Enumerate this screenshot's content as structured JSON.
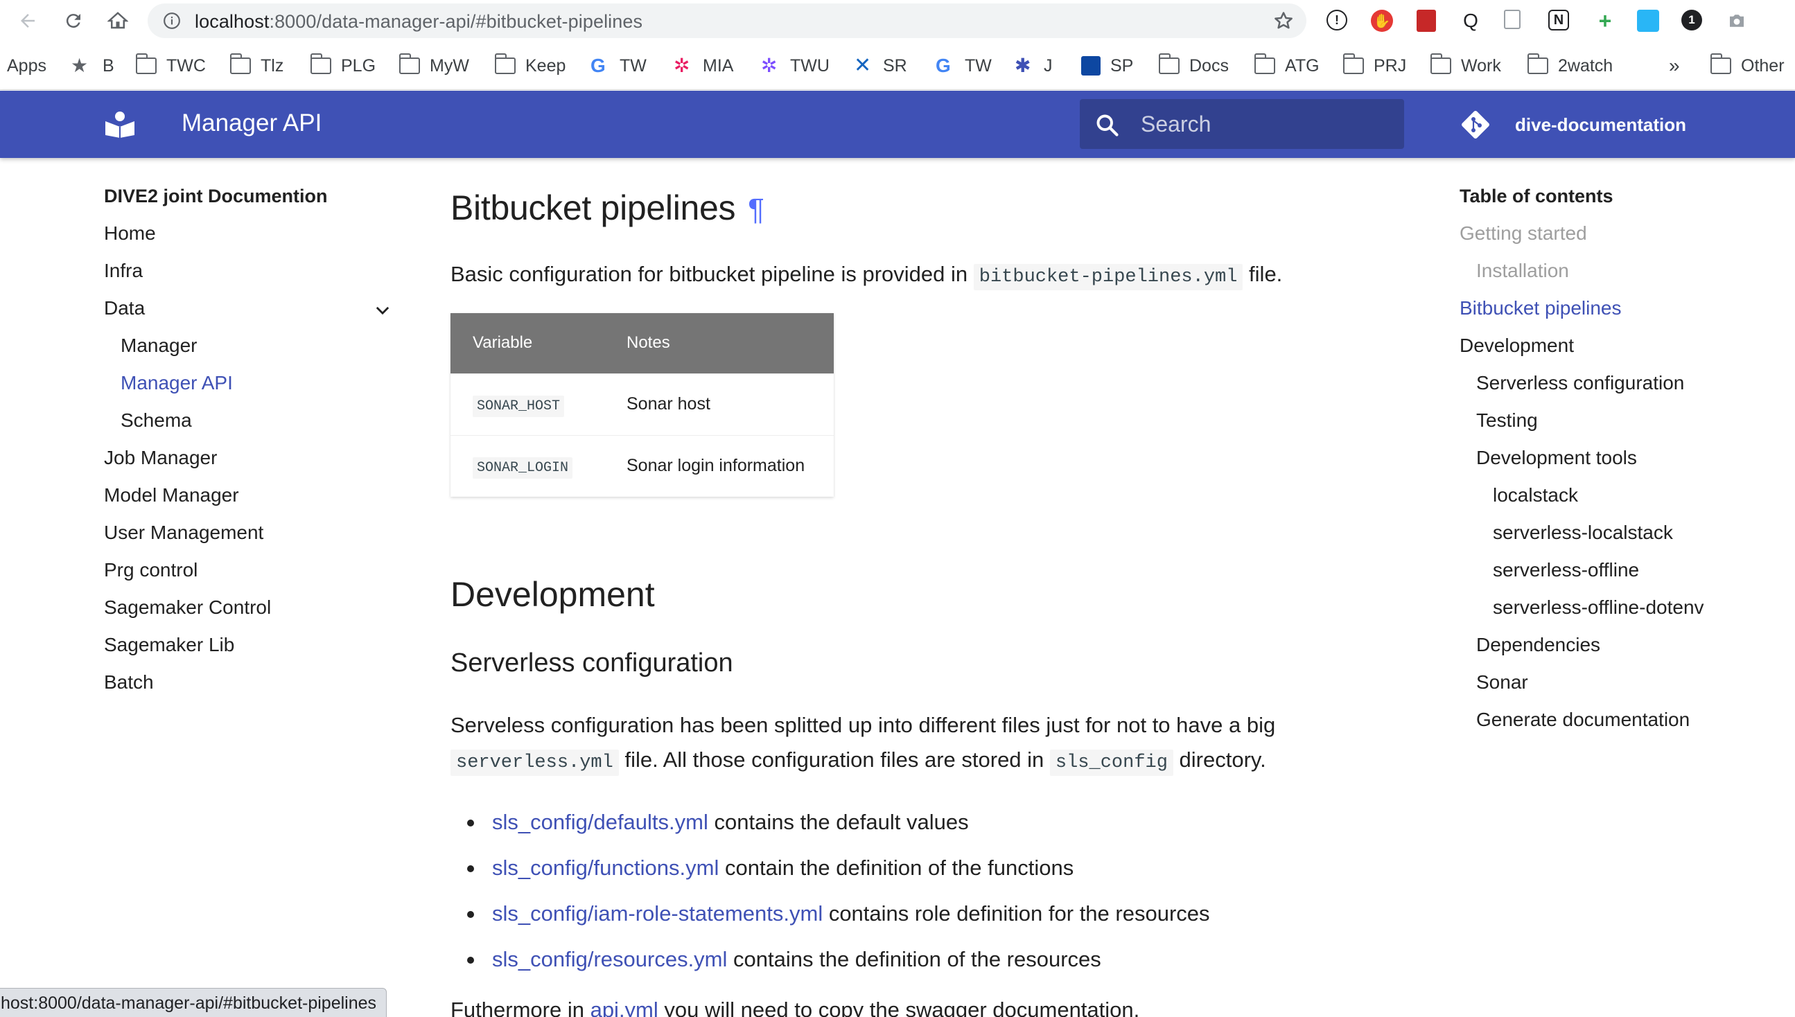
{
  "browser": {
    "url_host": "localhost",
    "url_rest": ":8000/data-manager-api/#bitbucket-pipelines",
    "bookmarks": [
      {
        "label": "Apps",
        "icon": "apps-icon"
      },
      {
        "label": "B",
        "icon": "star-icon"
      },
      {
        "label": "TWC",
        "icon": "folder-icon"
      },
      {
        "label": "Tlz",
        "icon": "folder-icon"
      },
      {
        "label": "PLG",
        "icon": "folder-icon"
      },
      {
        "label": "MyW",
        "icon": "folder-icon"
      },
      {
        "label": "Keep",
        "icon": "folder-icon"
      },
      {
        "label": "TW",
        "icon": "google-icon"
      },
      {
        "label": "MIA",
        "icon": "pinwheel-icon"
      },
      {
        "label": "TWU",
        "icon": "pinwheel-icon"
      },
      {
        "label": "SR",
        "icon": "confluence-icon"
      },
      {
        "label": "TW",
        "icon": "google-icon"
      },
      {
        "label": "J",
        "icon": "jira-icon"
      },
      {
        "label": "SP",
        "icon": "trello-icon"
      },
      {
        "label": "Docs",
        "icon": "folder-icon"
      },
      {
        "label": "ATG",
        "icon": "folder-icon"
      },
      {
        "label": "PRJ",
        "icon": "folder-icon"
      },
      {
        "label": "Work",
        "icon": "folder-icon"
      },
      {
        "label": "2watch",
        "icon": "folder-icon"
      },
      {
        "label": "Other",
        "icon": "folder-icon"
      }
    ],
    "overflow_label": "»",
    "status_bubble": "host:8000/data-manager-api/#bitbucket-pipelines"
  },
  "header": {
    "site_title": "Manager API",
    "search_placeholder": "Search",
    "repo_name": "dive-documentation"
  },
  "left_nav": {
    "title": "DIVE2 joint Documention",
    "items": [
      {
        "label": "Home"
      },
      {
        "label": "Infra"
      },
      {
        "label": "Data"
      },
      {
        "label": "Manager"
      },
      {
        "label": "Manager API"
      },
      {
        "label": "Schema"
      },
      {
        "label": "Job Manager"
      },
      {
        "label": "Model Manager"
      },
      {
        "label": "User Management"
      },
      {
        "label": "Prg control"
      },
      {
        "label": "Sagemaker Control"
      },
      {
        "label": "Sagemaker Lib"
      },
      {
        "label": "Batch"
      }
    ]
  },
  "content": {
    "h1": "Bitbucket pipelines",
    "pilcrow": "¶",
    "intro_before": "Basic configuration for bitbucket pipeline is provided in ",
    "intro_code": "bitbucket-pipelines.yml",
    "intro_after": " file.",
    "table": {
      "headers": [
        "Variable",
        "Notes"
      ],
      "rows": [
        {
          "variable": "SONAR_HOST",
          "notes": "Sonar host"
        },
        {
          "variable": "SONAR_LOGIN",
          "notes": "Sonar login information"
        }
      ]
    },
    "h2": "Development",
    "h3": "Serverless configuration",
    "para1_a": "Serveless configuration has been splitted up into different files just for not to have a big",
    "para1_code1": "serverless.yml",
    "para1_b": " file. All those configuration files are stored in ",
    "para1_code2": "sls_config",
    "para1_c": " directory.",
    "files": [
      {
        "link": "sls_config/defaults.yml",
        "text": " contains the default values"
      },
      {
        "link": "sls_config/functions.yml",
        "text": " contain the definition of the functions"
      },
      {
        "link": "sls_config/iam-role-statements.yml",
        "text": " contains role definition for the resources"
      },
      {
        "link": "sls_config/resources.yml",
        "text": " contains the definition of the resources"
      }
    ],
    "para2_a": "Futhermore in ",
    "para2_link": "api.yml",
    "para2_b": " you will need to copy the swagger documentation."
  },
  "toc": {
    "title": "Table of contents",
    "items": [
      {
        "label": "Getting started"
      },
      {
        "label": "Installation"
      },
      {
        "label": "Bitbucket pipelines"
      },
      {
        "label": "Development"
      },
      {
        "label": "Serverless configuration"
      },
      {
        "label": "Testing"
      },
      {
        "label": "Development tools"
      },
      {
        "label": "localstack"
      },
      {
        "label": "serverless-localstack"
      },
      {
        "label": "serverless-offline"
      },
      {
        "label": "serverless-offline-dotenv"
      },
      {
        "label": "Dependencies"
      },
      {
        "label": "Sonar"
      },
      {
        "label": "Generate documentation"
      }
    ]
  },
  "colors": {
    "primary": "#3f51b5",
    "accent": "#536dfe",
    "table_header": "#757575"
  }
}
